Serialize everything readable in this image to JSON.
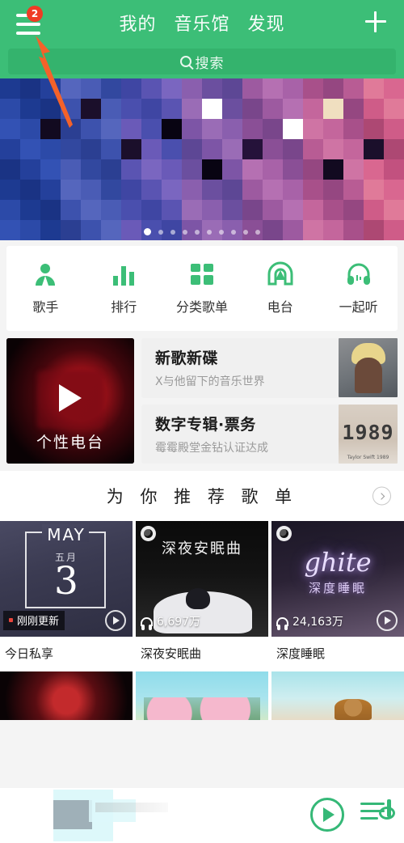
{
  "header": {
    "menu_badge": "2",
    "nav_items": [
      {
        "label": "我的",
        "active": false
      },
      {
        "label": "音乐馆",
        "active": true
      },
      {
        "label": "发现",
        "active": false
      }
    ],
    "add_label": "+",
    "search": {
      "placeholder": "搜索",
      "icon": "search-icon"
    },
    "accent_color": "#3cbe77",
    "badge_color": "#ef3b24"
  },
  "banner": {
    "dots_total": 10,
    "active_dot": 1
  },
  "quick_entries": [
    {
      "label": "歌手",
      "icon": "singer-icon"
    },
    {
      "label": "排行",
      "icon": "chart-bars-icon"
    },
    {
      "label": "分类歌单",
      "icon": "grid-icon"
    },
    {
      "label": "电台",
      "icon": "radio-icon"
    },
    {
      "label": "一起听",
      "icon": "headphones-icon"
    }
  ],
  "promo": {
    "radio_card": {
      "caption": "个性电台",
      "icon": "play-icon"
    },
    "rows": [
      {
        "title": "新歌新碟",
        "subtitle": "X与他留下的音乐世界",
        "thumb": "artist-portrait"
      },
      {
        "title": "数字专辑·票务",
        "subtitle": "霉霉殿堂金钻认证达成",
        "thumb": "album-1989",
        "thumb_number": "1989",
        "thumb_foot": "Taylor Swift   1989"
      }
    ]
  },
  "recommend": {
    "section_title": "为 你 推 荐 歌 单",
    "more_icon": "chevron-right-icon",
    "cards": [
      {
        "name": "今日私享",
        "art": "calendar",
        "cal_month_en": "MAY",
        "cal_month_cn": "五月",
        "cal_day": "3",
        "tag": "刚刚更新",
        "plays": "",
        "has_play_button": true,
        "has_corner_badge": false
      },
      {
        "name": "深夜安眠曲",
        "art": "sleep",
        "art_title": "深夜安眠曲",
        "plays": "6,697万",
        "has_play_button": false,
        "has_corner_badge": true
      },
      {
        "name": "深度睡眠",
        "art": "deep-sleep",
        "art_title": "ghite",
        "art_subtitle": "深度睡眠",
        "plays": "24,163万",
        "has_play_button": true,
        "has_corner_badge": true
      }
    ],
    "next_row_arts": [
      "concert",
      "sakura",
      "beach"
    ]
  },
  "player": {
    "play_icon": "play-icon",
    "playlist_icon": "playlist-icon"
  }
}
